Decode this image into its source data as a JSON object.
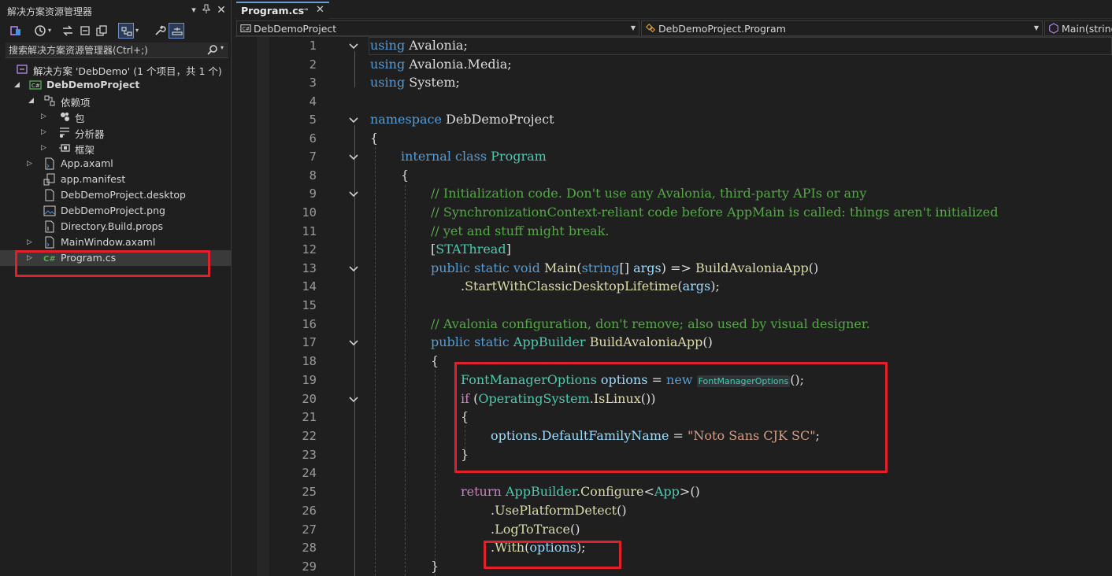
{
  "solution_explorer": {
    "title": "解决方案资源管理器",
    "search_placeholder": "搜索解决方案资源管理器(Ctrl+;)",
    "solution_label": "解决方案 'DebDemo' (1 个项目，共 1 个)",
    "project": "DebDemoProject",
    "dependencies": "依赖项",
    "deps": [
      "包",
      "分析器",
      "框架"
    ],
    "files": [
      "App.axaml",
      "app.manifest",
      "DebDemoProject.desktop",
      "DebDemoProject.png",
      "Directory.Build.props",
      "MainWindow.axaml",
      "Program.cs"
    ]
  },
  "editor": {
    "tab_title": "Program.cs",
    "nav_project": "DebDemoProject",
    "nav_class": "DebDemoProject.Program",
    "nav_member": "Main(string",
    "line_numbers": [
      "1",
      "2",
      "3",
      "4",
      "5",
      "6",
      "7",
      "8",
      "9",
      "10",
      "11",
      "12",
      "13",
      "14",
      "15",
      "16",
      "17",
      "18",
      "19",
      "20",
      "21",
      "22",
      "23",
      "24",
      "25",
      "26",
      "27",
      "28",
      "29"
    ],
    "code": {
      "l1_kw": "using",
      "l1_rest": " Avalonia;",
      "l2_kw": "using",
      "l2_rest": " Avalonia.Media;",
      "l3_kw": "using",
      "l3_rest": " System;",
      "l5_kw": "namespace",
      "l5_rest": " DebDemoProject",
      "l6": "{",
      "l7_kw1": "internal",
      "l7_kw2": " class",
      "l7_ty": " Program",
      "l8": "{",
      "l9": "// Initialization code. Don't use any Avalonia, third-party APIs or any",
      "l10": "// SynchronizationContext-reliant code before AppMain is called: things aren't initialized",
      "l11": "// yet and stuff might break.",
      "l12_a": "[",
      "l12_ty": "STAThread",
      "l12_b": "]",
      "l13_kw1": "public",
      "l13_kw2": " static",
      "l13_kw3": " void",
      "l13_fn": " Main",
      "l13_p1": "(",
      "l13_kw4": "string",
      "l13_p2": "[] ",
      "l13_id": "args",
      "l13_p3": ") => ",
      "l13_fn2": "BuildAvaloniaApp",
      "l13_p4": "()",
      "l14_p1": ".",
      "l14_fn": "StartWithClassicDesktopLifetime",
      "l14_p2": "(",
      "l14_id": "args",
      "l14_p3": ");",
      "l16": "// Avalonia configuration, don't remove; also used by visual designer.",
      "l17_kw1": "public",
      "l17_kw2": " static",
      "l17_ty": " AppBuilder",
      "l17_fn": " BuildAvaloniaApp",
      "l17_p": "()",
      "l18": "{",
      "l19_ty": "FontManagerOptions",
      "l19_id": " options",
      "l19_p1": " = ",
      "l19_kw": "new",
      "l19_hint": "FontManagerOptions",
      "l19_p2": "();",
      "l20_kw": "if",
      "l20_p1": " (",
      "l20_ty": "OperatingSystem",
      "l20_p2": ".",
      "l20_fn": "IsLinux",
      "l20_p3": "())",
      "l21": "{",
      "l22_id": "options",
      "l22_p1": ".",
      "l22_id2": "DefaultFamilyName",
      "l22_p2": " = ",
      "l22_st": "\"Noto Sans CJK SC\"",
      "l22_p3": ";",
      "l23": "}",
      "l25_kw": "return",
      "l25_ty": " AppBuilder",
      "l25_p1": ".",
      "l25_fn": "Configure",
      "l25_p2": "<",
      "l25_ty2": "App",
      "l25_p3": ">()",
      "l26_p1": ".",
      "l26_fn": "UsePlatformDetect",
      "l26_p2": "()",
      "l27_p1": ".",
      "l27_fn": "LogToTrace",
      "l27_p2": "()",
      "l28_p1": ".",
      "l28_fn": "With",
      "l28_p2": "(",
      "l28_id": "options",
      "l28_p3": ");",
      "l29": "}"
    }
  },
  "colors": {
    "keyword": "#569cd6",
    "type": "#4ec9b0",
    "comment": "#57a64a",
    "string": "#d69d85",
    "method": "#dcdcaa",
    "identifier": "#9cdcfe",
    "highlight_box": "#e0202a"
  }
}
